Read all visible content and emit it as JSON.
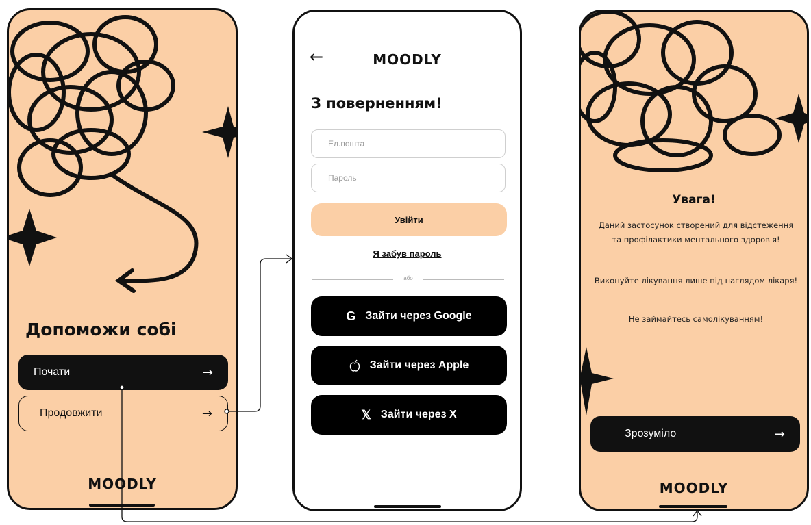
{
  "screen1": {
    "headline": "Допоможи собі",
    "start_label": "Почати",
    "continue_label": "Продовжити",
    "arrow_glyph": "→",
    "logo": "MOODLY"
  },
  "screen2": {
    "back_glyph": "←",
    "logo": "MOODLY",
    "title": "З поверненням!",
    "email_placeholder": "Ел.пошта",
    "password_placeholder": "Пароль",
    "login_label": "Увійти",
    "forgot_label": "Я забув пароль",
    "divider_text": "або",
    "google_icon": "G",
    "google_label": "Зайти через Google",
    "apple_icon": "",
    "apple_label": "Зайти через Apple",
    "x_icon": "𝕏",
    "x_label": "Зайти через X"
  },
  "screen3": {
    "title": "Увага!",
    "paragraph1": "Даний застосунок створений для відстеження та профілактики ментального здоров'я!",
    "paragraph2": "Виконуйте лікування лише під наглядом лікаря!",
    "paragraph3": "Не займайтесь самолікуванням!",
    "ok_label": "Зрозуміло",
    "arrow_glyph": "→",
    "logo": "MOODLY"
  },
  "colors": {
    "peach": "#fbcfa6",
    "dark": "#111111",
    "white": "#ffffff"
  },
  "icons": [
    "arrow-right-icon",
    "back-arrow-icon",
    "google-icon",
    "apple-icon",
    "x-icon",
    "star-icon",
    "scribble-decoration"
  ]
}
